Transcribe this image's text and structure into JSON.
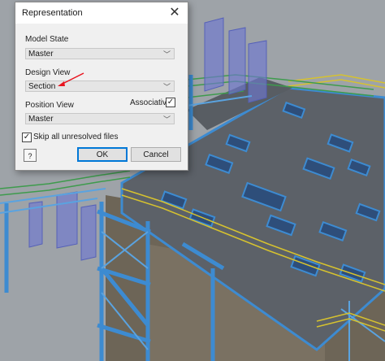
{
  "dialog": {
    "title": "Representation",
    "model_state": {
      "label": "Model State",
      "value": "Master"
    },
    "design_view": {
      "label": "Design View",
      "value": "Section"
    },
    "position_view": {
      "label": "Position View",
      "value": "Master"
    },
    "associative": {
      "label": "Associative",
      "checked": true
    },
    "skip_unresolved": {
      "label": "Skip all unresolved files",
      "checked": true
    },
    "ok_label": "OK",
    "cancel_label": "Cancel",
    "help_icon": "help-icon",
    "close_icon": "close-icon",
    "chevron_icon": "chevron-down-icon",
    "arrow_color": "#e8141e"
  },
  "viewport": {
    "colors": {
      "beam_blue": "#3d8bd1",
      "slab_gray": "#5c6168",
      "railing_yellow": "#d6c22f",
      "railing_green": "#3e9b4d",
      "section_plane": "#6e78cf",
      "background": "#9ea3a8",
      "lower_wall": "#6d6557"
    }
  }
}
